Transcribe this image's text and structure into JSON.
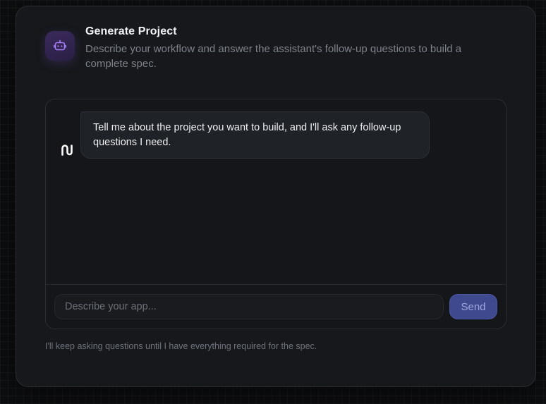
{
  "header": {
    "icon": "robot-icon",
    "title": "Generate Project",
    "subtitle": "Describe your workflow and answer the assistant's follow-up questions to build a complete spec."
  },
  "chat": {
    "messages": [
      {
        "sender_icon": "assistant-logo-icon",
        "text": "Tell me about the project you want to build, and I'll ask any follow-up questions I need."
      }
    ]
  },
  "composer": {
    "placeholder": "Describe your app...",
    "value": "",
    "send_label": "Send"
  },
  "footer": {
    "note": "I'll keep asking questions until I have everything required for the spec."
  },
  "colors": {
    "accent": "#3f4a8e",
    "icon_accent": "#a67ef5",
    "background": "#0d0e10",
    "card": "#16181b"
  }
}
